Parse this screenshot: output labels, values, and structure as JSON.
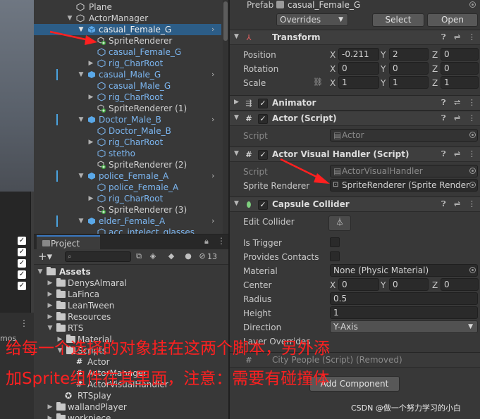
{
  "hierarchy": {
    "rows": [
      {
        "label": "Plane",
        "kind": "plain"
      },
      {
        "label": "ActorManager",
        "kind": "plain"
      },
      {
        "label": "casual_Female_G",
        "kind": "prefab"
      },
      {
        "label": "SpriteRenderer",
        "kind": "plain"
      },
      {
        "label": "casual_Female_G",
        "kind": "prefab"
      },
      {
        "label": "rig_CharRoot",
        "kind": "prefab"
      },
      {
        "label": "casual_Male_G",
        "kind": "prefab"
      },
      {
        "label": "casual_Male_G",
        "kind": "prefab"
      },
      {
        "label": "rig_CharRoot",
        "kind": "prefab"
      },
      {
        "label": "SpriteRenderer (1)",
        "kind": "plain"
      },
      {
        "label": "Doctor_Male_B",
        "kind": "prefab"
      },
      {
        "label": "Doctor_Male_B",
        "kind": "prefab"
      },
      {
        "label": "rig_CharRoot",
        "kind": "prefab"
      },
      {
        "label": "stetho",
        "kind": "prefab"
      },
      {
        "label": "SpriteRenderer (2)",
        "kind": "plain"
      },
      {
        "label": "police_Female_A",
        "kind": "prefab"
      },
      {
        "label": "police_Female_A",
        "kind": "prefab"
      },
      {
        "label": "rig_CharRoot",
        "kind": "prefab"
      },
      {
        "label": "SpriteRenderer (3)",
        "kind": "plain"
      },
      {
        "label": "elder_Female_A",
        "kind": "prefab"
      },
      {
        "label": "acc_intelect_glasses",
        "kind": "prefab"
      }
    ]
  },
  "scene": {
    "gizmos_label": "mos"
  },
  "project": {
    "tab_label": "Project",
    "hidden_count": "13",
    "rows": [
      {
        "label": "Assets",
        "bold": true
      },
      {
        "label": "DenysAlmaral"
      },
      {
        "label": "LaFinca"
      },
      {
        "label": "LeanTween"
      },
      {
        "label": "Resources"
      },
      {
        "label": "RTS"
      },
      {
        "label": "Material"
      },
      {
        "label": "Scripts"
      },
      {
        "label": "Actor"
      },
      {
        "label": "ActorManager"
      },
      {
        "label": "ActorVisualHandler"
      },
      {
        "label": "RTSplay"
      },
      {
        "label": "wallandPlayer"
      },
      {
        "label": "workpiece"
      }
    ]
  },
  "inspector": {
    "prefab_label": "Prefab",
    "prefab_value": "casual_Female_G",
    "overrides_label": "Overrides",
    "select_label": "Select",
    "open_label": "Open",
    "transform": {
      "title": "Transform",
      "position_label": "Position",
      "rotation_label": "Rotation",
      "scale_label": "Scale",
      "position": {
        "x": "-0.211",
        "y": "2",
        "z": "0"
      },
      "rotation": {
        "x": "0",
        "y": "0",
        "z": "0"
      },
      "scale": {
        "x": "1",
        "y": "1",
        "z": "1"
      }
    },
    "animator_title": "Animator",
    "actor": {
      "title": "Actor (Script)",
      "script_label": "Script",
      "script_value": "Actor"
    },
    "visual": {
      "title": "Actor Visual Handler (Script)",
      "script_label": "Script",
      "script_value": "ActorVisualHandler",
      "sprite_label": "Sprite Renderer",
      "sprite_value": "SpriteRenderer (Sprite Render"
    },
    "collider": {
      "title": "Capsule Collider",
      "edit_label": "Edit Collider",
      "trigger_label": "Is Trigger",
      "contacts_label": "Provides Contacts",
      "material_label": "Material",
      "material_value": "None (Physic Material)",
      "center_label": "Center",
      "center": {
        "x": "0",
        "y": "0",
        "z": "0"
      },
      "radius_label": "Radius",
      "radius_value": "0.5",
      "height_label": "Height",
      "height_value": "1",
      "direction_label": "Direction",
      "direction_value": "Y-Axis",
      "layer_label": "Layer Overrides"
    },
    "removed_title": "City People (Script) (Removed)",
    "add_component": "Add Component",
    "axis": {
      "x": "X",
      "y": "Y",
      "z": "Z"
    }
  },
  "annotation": {
    "line1": "给每一个选择的对象挂在这两个脚本，另外添",
    "line2": "加Sprite组件在其里面，注意：需要有碰撞体",
    "color": "#ff2020"
  },
  "watermark": "CSDN @做一个努力学习的小白"
}
